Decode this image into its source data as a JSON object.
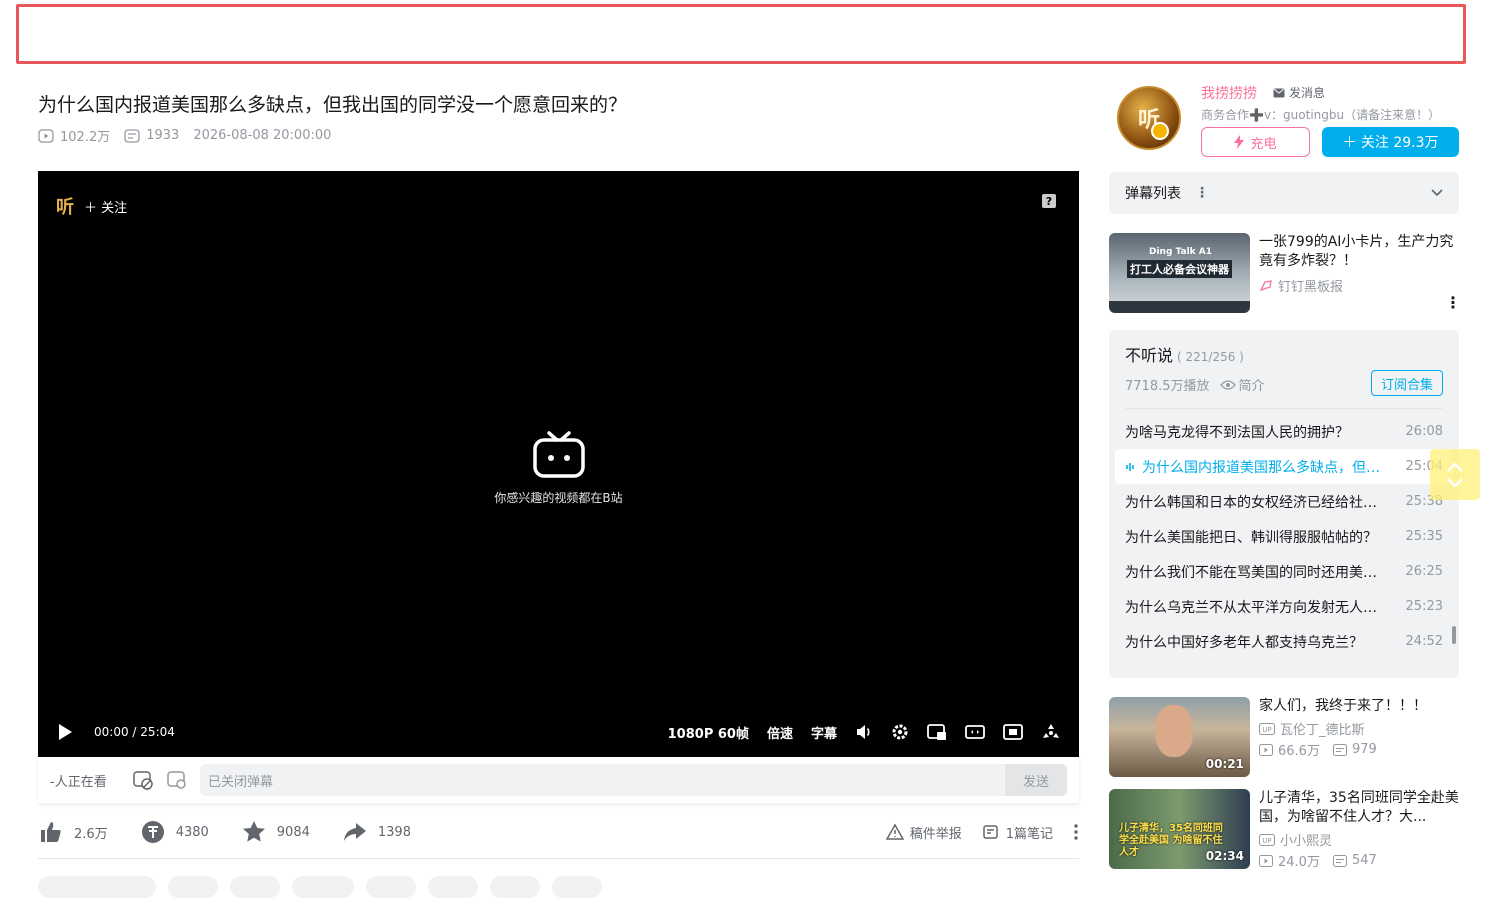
{
  "video": {
    "title": "为什么国内报道美国那么多缺点，但我出国的同学没一个愿意回来的？",
    "views": "102.2万",
    "danmaku_count": "1933",
    "date": "2026-08-08 20:00:00"
  },
  "player": {
    "logo_text": "听",
    "follow_label": "＋ 关注",
    "center_text": "你感兴趣的视频都在B站",
    "time_current": "00:00",
    "time_separator": "/",
    "time_total": "25:04",
    "quality": "1080P 60帧",
    "speed": "倍速",
    "subtitle": "字幕"
  },
  "danmaku_bar": {
    "watching": "-人正在看",
    "input_placeholder": "已关闭弹幕",
    "send": "发送"
  },
  "toolbar": {
    "like": "2.6万",
    "coin": "4380",
    "favorite": "9084",
    "share": "1398",
    "report": "稿件举报",
    "notes": "1篇笔记"
  },
  "tags": [
    "",
    "",
    "",
    "",
    "",
    "",
    "",
    "",
    ""
  ],
  "uploader": {
    "name": "我捞捞捞",
    "message": "发消息",
    "desc": "商务合作➕v：guotingbu（请备注来意！）",
    "charge": "充电",
    "follow": "＋ 关注 29.3万",
    "avatar_text": "听"
  },
  "danmaku_list": {
    "label": "弹幕列表"
  },
  "recommend": [
    {
      "title": "一张799的AI小卡片，生产力究竟有多炸裂？！",
      "author": "钉钉黑板报",
      "thumb_text": "打工人必备会议神器",
      "thumb_text2": "Ding Talk A1"
    },
    {
      "title": "家人们，我终于来了！！！",
      "author": "瓦伦丁_德比斯",
      "views": "66.6万",
      "danmaku": "979",
      "duration": "00:21"
    },
    {
      "title": "儿子清华，35名同班同学全赴美国，为啥留不住人才？大...",
      "author": "小小熙灵",
      "views": "24.0万",
      "danmaku": "547",
      "duration": "02:34",
      "thumb_text": "儿子清华，35名同班同学全赴美国 为啥留不住人才"
    }
  ],
  "playlist": {
    "title": "不听说",
    "count": "( 221/256 )",
    "plays": "7718.5万播放",
    "intro": "简介",
    "subscribe": "订阅合集",
    "items": [
      {
        "title": "为啥马克龙得不到法国人民的拥护？",
        "duration": "26:08"
      },
      {
        "title": "为什么国内报道美国那么多缺点，但我出国的同学没一个愿意回来的？",
        "duration": "25:04"
      },
      {
        "title": "为什么韩国和日本的女权经济已经给社会带来困扰了？",
        "duration": "25:38"
      },
      {
        "title": "为什么美国能把日、韩训得服服帖帖的？",
        "duration": "25:35"
      },
      {
        "title": "为什么我们不能在骂美国的同时还用美国货？",
        "duration": "26:25"
      },
      {
        "title": "为什么乌克兰不从太平洋方向发射无人机？",
        "duration": "25:23"
      },
      {
        "title": "为什么中国好多老年人都支持乌克兰？",
        "duration": "24:52"
      },
      {
        "title": "",
        "duration": ""
      }
    ]
  },
  "colors": {
    "accent": "#00aeec",
    "pink": "#fb7299",
    "frame": "#e8575a"
  }
}
